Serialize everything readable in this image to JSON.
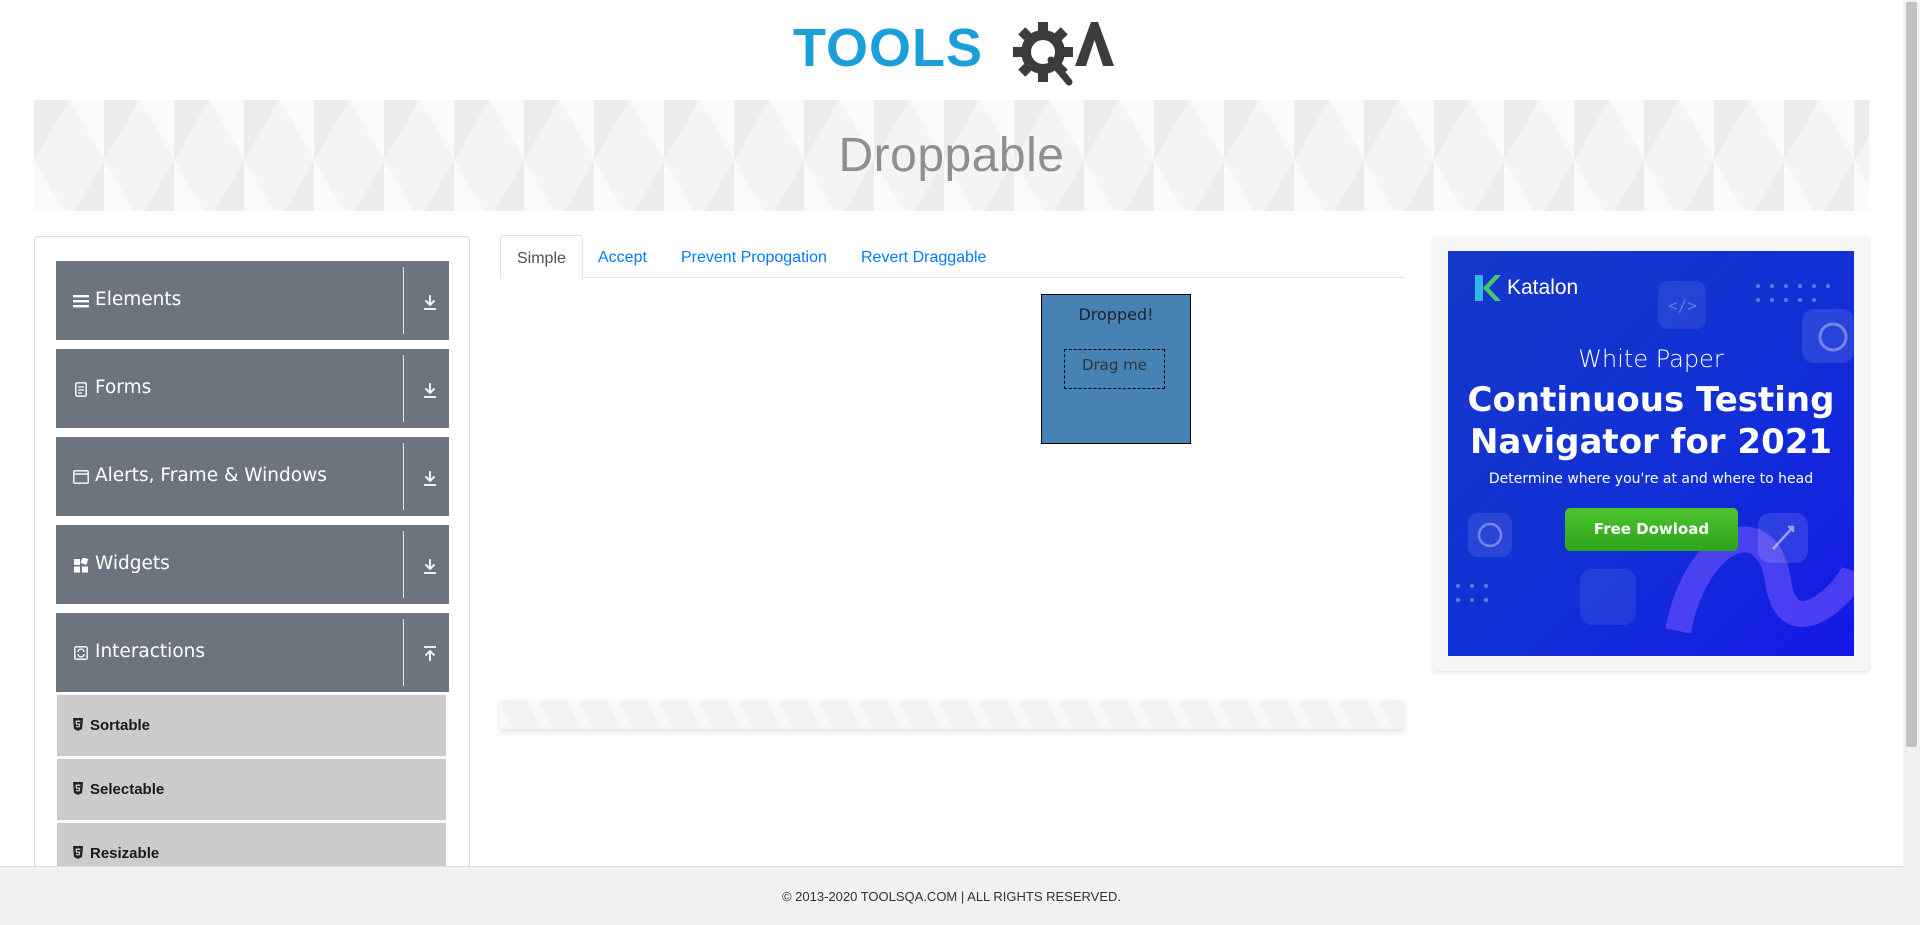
{
  "header": {
    "logo_text": "TOOLSQA"
  },
  "banner": {
    "title": "Droppable"
  },
  "sidebar": {
    "groups": [
      {
        "label": "Elements",
        "icon": "menu-icon",
        "state": "collapsed"
      },
      {
        "label": "Forms",
        "icon": "form-icon",
        "state": "collapsed"
      },
      {
        "label": "Alerts, Frame & Windows",
        "icon": "window-icon",
        "state": "collapsed"
      },
      {
        "label": "Widgets",
        "icon": "widgets-icon",
        "state": "collapsed"
      },
      {
        "label": "Interactions",
        "icon": "interactions-icon",
        "state": "expanded"
      }
    ],
    "items": [
      {
        "label": "Sortable"
      },
      {
        "label": "Selectable"
      },
      {
        "label": "Resizable"
      }
    ]
  },
  "tabs": [
    {
      "label": "Simple",
      "active": true
    },
    {
      "label": "Accept",
      "active": false
    },
    {
      "label": "Prevent Propogation",
      "active": false
    },
    {
      "label": "Revert Draggable",
      "active": false
    }
  ],
  "droppable": {
    "text": "Dropped!",
    "color": "#4682b4"
  },
  "draggable": {
    "text": "Drag me"
  },
  "ad": {
    "brand": "Katalon",
    "kicker": "White Paper",
    "headline_1": "Continuous Testing",
    "headline_2": "Navigator for 2021",
    "subtext": "Determine where you're at and where to head",
    "cta": "Free Dowload"
  },
  "footer": {
    "text": "© 2013-2020 TOOLSQA.COM | ALL RIGHTS RESERVED."
  },
  "colors": {
    "accent": "#007bff",
    "sidebar_group": "#6c757d",
    "sidebar_item": "#cbcbcb",
    "logo_blue": "#1b9fd8"
  }
}
